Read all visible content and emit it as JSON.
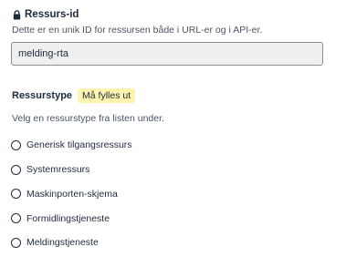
{
  "resource_id": {
    "label": "Ressurs-id",
    "description": "Dette er en unik ID for ressursen både i URL-er og i API-er.",
    "value": "melding-rta",
    "icon": "lock-icon"
  },
  "resource_type": {
    "label": "Ressurstype",
    "required_badge": "Må fylles ut",
    "description": "Velg en ressurstype fra listen under.",
    "options": [
      {
        "label": "Generisk tilgangsressurs"
      },
      {
        "label": "Systemressurs"
      },
      {
        "label": "Maskinporten-skjema"
      },
      {
        "label": "Formidlingstjeneste"
      },
      {
        "label": "Meldingstjeneste"
      }
    ]
  },
  "colors": {
    "text": "#1e2b3c",
    "muted": "#4a5562",
    "badge_bg": "#fff3b0",
    "input_bg": "#efefef"
  }
}
